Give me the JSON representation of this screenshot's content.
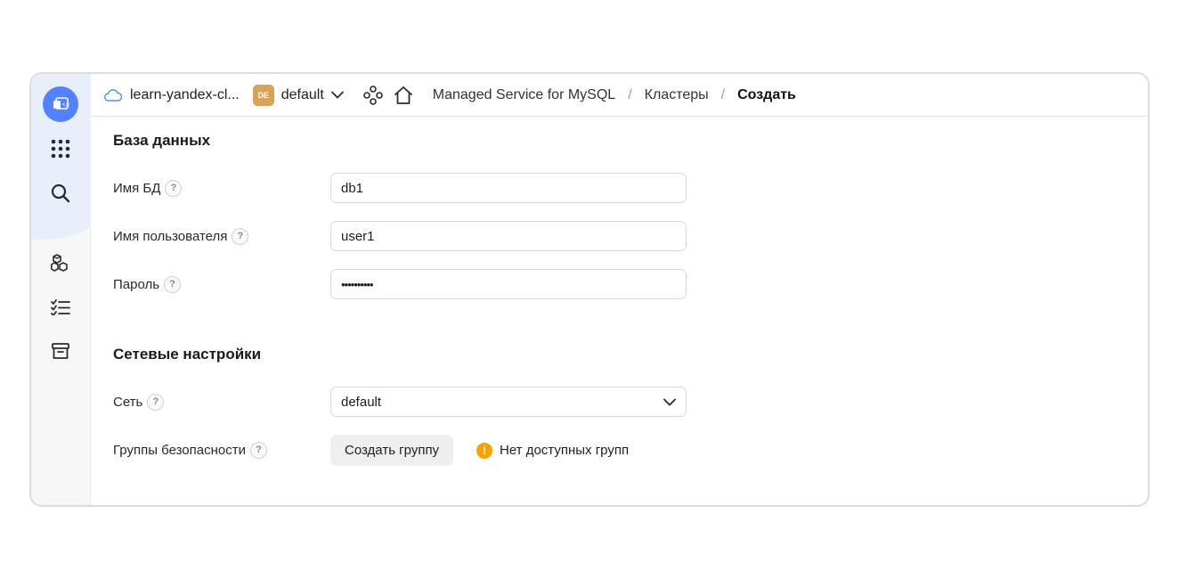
{
  "header": {
    "cloud_name": "learn-yandex-cl...",
    "folder_badge": "DE",
    "folder_name": "default",
    "breadcrumbs": [
      "Managed Service for MySQL",
      "Кластеры",
      "Создать"
    ],
    "separator": "/"
  },
  "sidebar": {
    "items": [
      {
        "icon": "console-icon"
      },
      {
        "icon": "apps-grid-icon"
      },
      {
        "icon": "search-icon"
      },
      {
        "icon": "resources-cubes-icon"
      },
      {
        "icon": "checklist-icon"
      },
      {
        "icon": "archive-icon"
      }
    ]
  },
  "database": {
    "title": "База данных",
    "db_name_label": "Имя БД",
    "db_name_value": "db1",
    "user_label": "Имя пользователя",
    "user_value": "user1",
    "password_label": "Пароль",
    "password_value": "••••••••••"
  },
  "network": {
    "title": "Сетевые настройки",
    "network_label": "Сеть",
    "network_value": "default",
    "groups_label": "Группы безопасности",
    "create_group_label": "Создать группу",
    "warning_text": "Нет доступных групп"
  },
  "help_mark": "?",
  "warning_mark": "!",
  "colors": {
    "accent": "#5282ff",
    "folder_badge": "#d9a25a",
    "warning": "#f5a300"
  }
}
